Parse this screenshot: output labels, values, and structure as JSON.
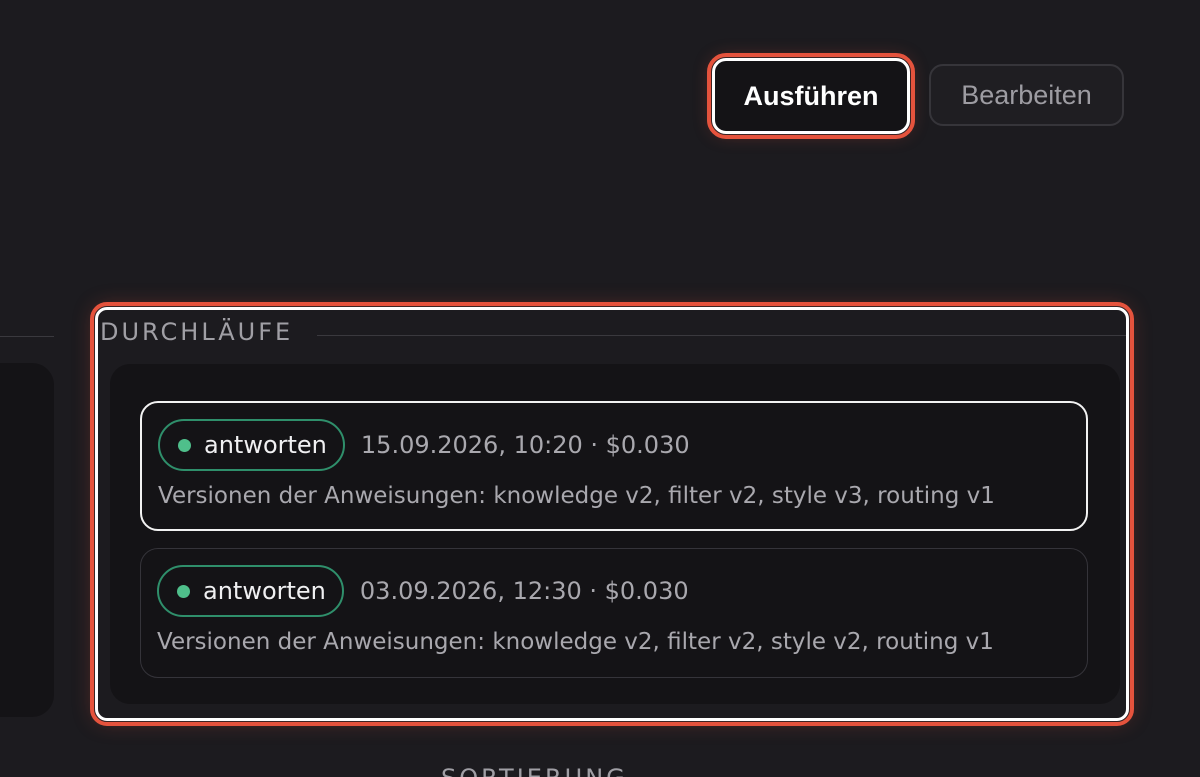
{
  "toolbar": {
    "run_label": "Ausführen",
    "edit_label": "Bearbeiten"
  },
  "runs": {
    "heading": "DURCHLÄUFE",
    "items": [
      {
        "status": "antworten",
        "meta": "15.09.2026, 10:20 · $0.030",
        "description": "Versionen der Anweisungen: knowledge v2, filter v2, style v3, routing v1",
        "selected": true
      },
      {
        "status": "antworten",
        "meta": "03.09.2026, 12:30 · $0.030",
        "description": "Versionen der Anweisungen: knowledge v2, filter v2, style v2, routing v1",
        "selected": false
      }
    ]
  },
  "sort": {
    "heading": "SORTIERUNG"
  },
  "colors": {
    "background": "#1c1b1f",
    "highlight": "#e5533d",
    "status_green": "#4fbf8b"
  }
}
